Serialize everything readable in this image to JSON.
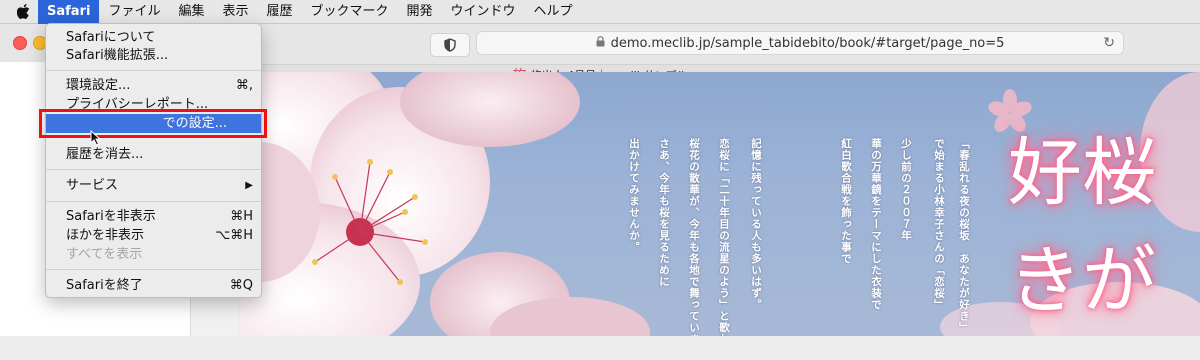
{
  "menubar": {
    "app": "Safari",
    "items": [
      "ファイル",
      "編集",
      "表示",
      "履歴",
      "ブックマーク",
      "開発",
      "ウインドウ",
      "ヘルプ"
    ]
  },
  "toolbar": {
    "url": "demo.meclib.jp/sample_tabidebito/book/#target/page_no=5"
  },
  "tab": {
    "favicon": "旅",
    "title": "旅出人 4月号｜meclibサンプル"
  },
  "dropdown": {
    "about": "Safariについて",
    "extensions": "Safari機能拡張...",
    "preferences": "環境設定...",
    "preferences_shortcut": "⌘,",
    "privacy_report": "プライバシーレポート...",
    "site_settings": "での設定...",
    "clear_history": "履歴を消去...",
    "services": "サービス",
    "services_arrow": "▶",
    "hide_safari": "Safariを非表示",
    "hide_safari_shortcut": "⌘H",
    "hide_others": "ほかを非表示",
    "hide_others_shortcut": "⌥⌘H",
    "show_all": "すべてを表示",
    "quit": "Safariを終了",
    "quit_shortcut": "⌘Q"
  },
  "page": {
    "vertical_columns": [
      "「春乱れる夜の桜坂　あなたが好き」",
      "で始まる小林幸子さんの「恋桜」",
      "少し前の２００７年",
      "華の万華鏡をテーマにした衣装で",
      "紅白歌合戦を飾った事で",
      "記憶に残っている人も多いはず。",
      "恋桜に「二十年目の流星のよう」と歌われた",
      "桜花の散華が、今年も各地で舞っています。",
      "さあ、今年も桜を見るために",
      "出かけてみませんか。"
    ],
    "title_line1": "好桜",
    "title_line2": "きが"
  },
  "colors": {
    "menu_highlight": "#3d74de",
    "red_box": "#ee1111",
    "title_glow": "#ff6f95"
  }
}
